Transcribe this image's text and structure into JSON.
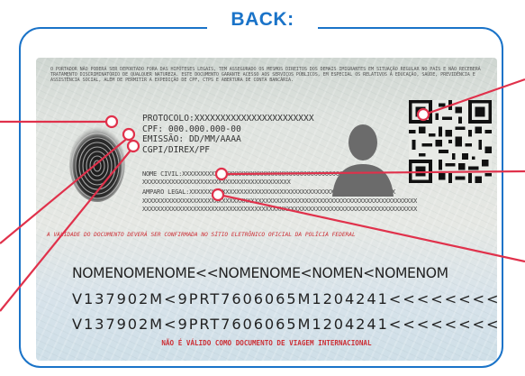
{
  "header": {
    "title": "BACK:"
  },
  "card": {
    "legal_text": "O PORTADOR NÃO PODERÁ SER DEPORTADO FORA DAS HIPÓTESES LEGAIS, TEM ASSEGURADO OS MESMOS DIREITOS DOS DEMAIS IMIGRANTES EM SITUAÇÃO REGULAR NO PAÍS E NÃO RECEBERÁ TRATAMENTO DISCRIMINATÓRIO DE QUALQUER NATUREZA. ESTE DOCUMENTO GARANTE ACESSO AOS SERVIÇOS PÚBLICOS, EM ESPECIAL OS RELATIVOS À EDUCAÇÃO, SAÚDE, PREVIDÊNCIA E ASSISTÊNCIA SOCIAL, ALÉM DE PERMITIR A EXPEDIÇÃO DE CPF, CTPS E ABERTURA DE CONTA BANCÁRIA.",
    "protocolo": "PROTOCOLO:XXXXXXXXXXXXXXXXXXXXXXX",
    "cpf": "CPF: 000.000.000-00",
    "emissao": "EMISSÃO: DD/MM/AAAA",
    "issuer": "CGPI/DIREX/PF",
    "nome_civil": "NOME CIVIL:XXXXXXXXXXXXXXXXXXXXXXXXXXXXXXXXXXXXXXXXXXXXXX",
    "filler_1": "XXXXXXXXXXXXXXXXXXXXXXXXXXXXXXXXXXXXXXXXX",
    "amparo_legal": "AMPARO LEGAL:XXXXXXXXXXXXXXXXXXXXXXXXXXXXXXXXXXXXXXXXXXXXXXXXXXXXXXXXX",
    "filler_2": "XXXXXXXXXXXXXXXXXXXXXXXXXXXXXXXXXXXXXXXXXXXXXXXXXXXXXXXXXXXXXXXXXXXXXXXXXXXX",
    "filler_3": "XXXXXXXXXXXXXXXXXXXXXXXXXXXXXXXXXXXXXXXXXXXXXXXXXXXXXXXXXXXXXXXXXXXXXXXXXXXX",
    "validity_note": "A VALIDADE DO DOCUMENTO DEVERÁ SER CONFIRMADA NO SÍTIO ELETRÔNICO OFICIAL DA POLÍCIA FEDERAL",
    "mrz_line_1": "NOMENOMENOME<<NOMENOME<NOMEN<NOMENOM",
    "mrz_line_2": "V137902M<9PRT7606065M1204241<<<<<<<<",
    "mrz_line_3": "V137902M<9PRT7606065M1204241<<<<<<<<",
    "footer": "NÃO É VÁLIDO COMO DOCUMENTO DE VIAGEM INTERNACIONAL"
  },
  "colors": {
    "frame": "#1a73c8",
    "callout": "#e0314b",
    "red_text": "#cc2f35"
  },
  "icons": [
    "fingerprint-icon",
    "person-silhouette-icon",
    "qr-code-icon"
  ]
}
